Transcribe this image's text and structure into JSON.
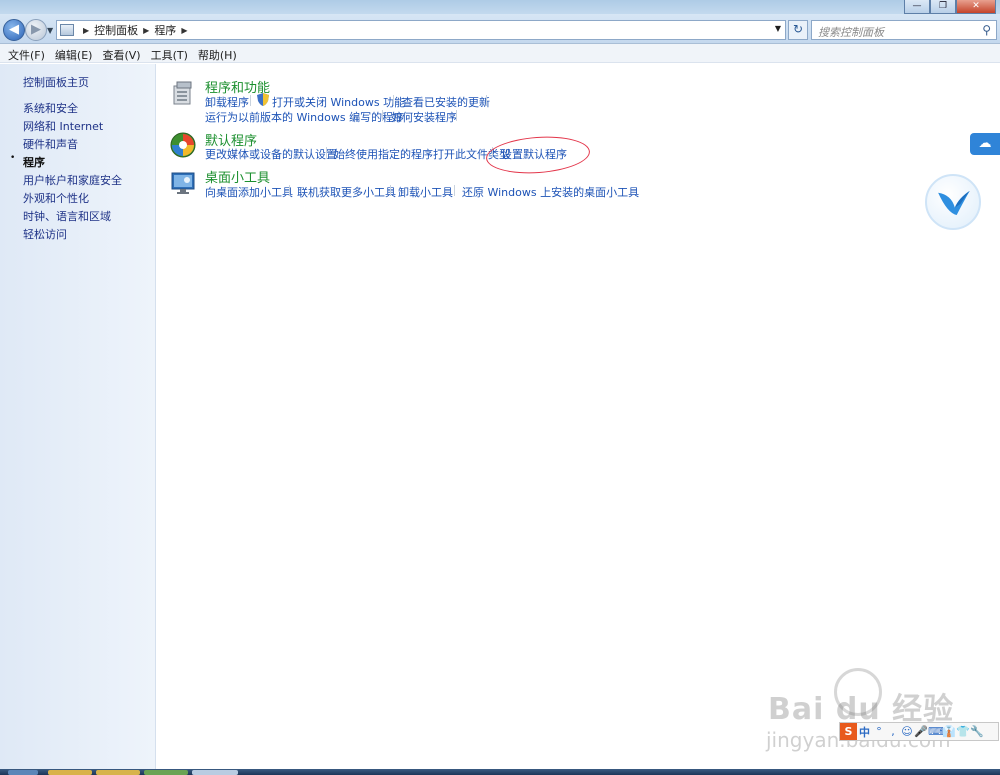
{
  "window": {
    "minimize_glyph": "—",
    "maximize_glyph": "❐",
    "close_glyph": "✕"
  },
  "address_bar": {
    "back_glyph": "◀",
    "forward_glyph": "▶",
    "crumbs": [
      "控制面板",
      "程序"
    ],
    "separator": "▶",
    "refresh_glyph": "↻",
    "search_placeholder": "搜索控制面板"
  },
  "menu": [
    "文件(F)",
    "编辑(E)",
    "查看(V)",
    "工具(T)",
    "帮助(H)"
  ],
  "sidebar": {
    "home": "控制面板主页",
    "items": [
      "系统和安全",
      "网络和 Internet",
      "硬件和声音",
      "程序",
      "用户帐户和家庭安全",
      "外观和个性化",
      "时钟、语言和区域",
      "轻松访问"
    ],
    "active_bullet": "•"
  },
  "categories": {
    "programs_features": {
      "title": "程序和功能",
      "tasks": [
        "卸载程序",
        "打开或关闭 Windows 功能",
        "查看已安装的更新",
        "运行为以前版本的 Windows 编写的程序",
        "如何安装程序"
      ]
    },
    "default_programs": {
      "title": "默认程序",
      "tasks": [
        "更改媒体或设备的默认设置",
        "始终使用指定的程序打开此文件类型",
        "设置默认程序"
      ]
    },
    "gadgets": {
      "title": "桌面小工具",
      "tasks": [
        "向桌面添加小工具",
        "联机获取更多小工具",
        "卸载小工具",
        "还原 Windows 上安装的桌面小工具"
      ]
    }
  },
  "watermark": {
    "logo": "Bai du 经验",
    "url": "jingyan.baidu.com"
  },
  "ime": {
    "logo": "S",
    "mode": "中",
    "glyphs": [
      "°",
      ",",
      "☺",
      "🎤",
      "⌨",
      "👔",
      "👕",
      "🔧"
    ]
  },
  "colors": {
    "link": "#1d53b6",
    "category_title": "#1b8f2e",
    "annotation": "#e3354a"
  }
}
